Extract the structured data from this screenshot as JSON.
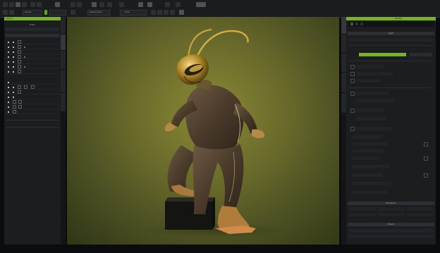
{
  "colors": {
    "accent": "#74b61f",
    "panel": "#1b1d1f",
    "viewport_center": "#8a8936",
    "viewport_edge": "#2f3516"
  },
  "toolbar": {
    "gizmo_mode_label": "Global",
    "viewport_label": "Perspective",
    "render_mode_label": "Pose"
  },
  "left_panel": {
    "title": "Scene",
    "header": "Prism",
    "tabs": [
      "Content",
      "Assets",
      "Scene",
      "Modifier",
      "Visual Effects",
      "Manipulation"
    ]
  },
  "right_panel": {
    "title": "Modify",
    "section_light": "Light",
    "section_transform": "Transform",
    "section_attach": "Attach",
    "tabs": [
      "Modify",
      "Visual",
      "Smart",
      "Material",
      "Camera",
      "Animation"
    ]
  },
  "viewport": {
    "subject": "stylized insect character crouching on a black box"
  }
}
